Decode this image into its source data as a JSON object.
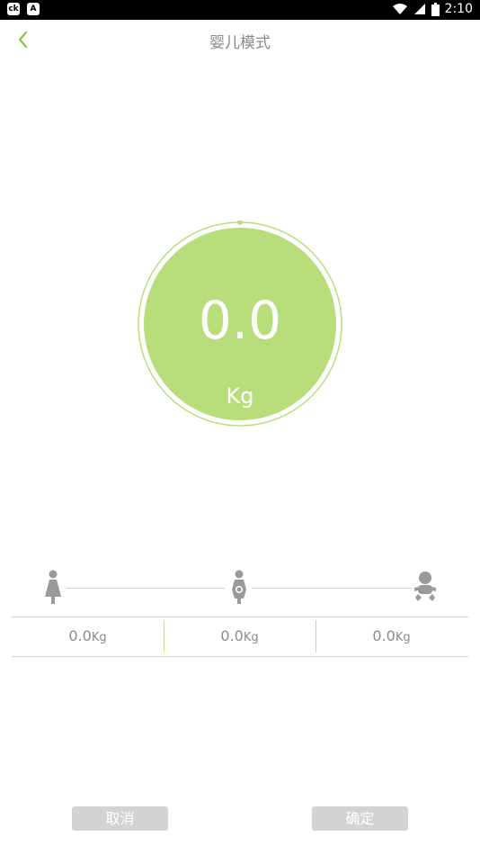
{
  "status_bar": {
    "left_icons": [
      "app-notification-icon",
      "app-notification-icon-2"
    ],
    "right_icons": [
      "wifi-icon",
      "cell-signal-icon",
      "battery-icon"
    ],
    "time": "2:10"
  },
  "header": {
    "title": "婴儿模式",
    "back_icon": "chevron-left-icon"
  },
  "scale": {
    "value": "0.0",
    "unit": "Kg"
  },
  "stages": {
    "icons": [
      "mother-icon",
      "mother-with-baby-icon",
      "baby-icon"
    ],
    "readings": [
      {
        "value": "0.0",
        "unit": "Kg"
      },
      {
        "value": "0.0",
        "unit": "Kg"
      },
      {
        "value": "0.0",
        "unit": "Kg"
      }
    ]
  },
  "buttons": {
    "cancel": "取消",
    "confirm": "确定"
  },
  "colors": {
    "accent": "#8cc63f",
    "circle_fill": "#b8de7b",
    "line": "#c3df9c",
    "text_gray": "#8a8a8a",
    "button_bg": "#d3d3d3"
  }
}
